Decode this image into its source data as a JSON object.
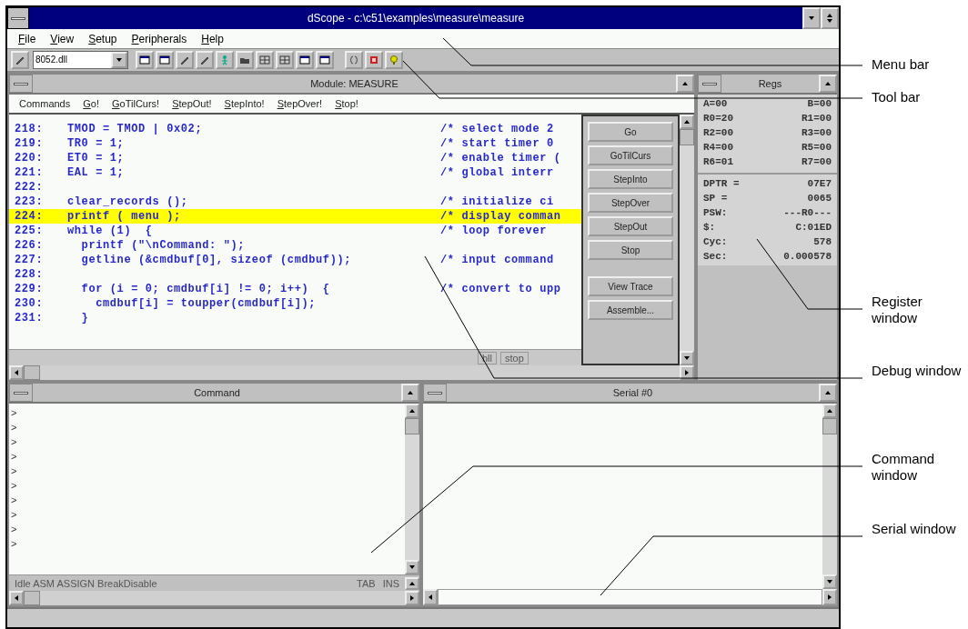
{
  "window": {
    "title": "dScope - c:\\c51\\examples\\measure\\measure"
  },
  "menu_bar": [
    "File",
    "View",
    "Setup",
    "Peripherals",
    "Help"
  ],
  "toolbar": {
    "dll_combo": "8052.dll"
  },
  "debug_window": {
    "title": "Module: MEASURE",
    "commands": [
      "Commands",
      "Go!",
      "GoTilCurs!",
      "StepOut!",
      "StepInto!",
      "StepOver!",
      "Stop!"
    ],
    "lines": [
      {
        "number": "218:",
        "code": "TMOD = TMOD | 0x02;",
        "comment": "/* select mode 2",
        "current": false
      },
      {
        "number": "219:",
        "code": "TR0 = 1;",
        "comment": "/* start timer 0",
        "current": false
      },
      {
        "number": "220:",
        "code": "ET0 = 1;",
        "comment": "/* enable timer (",
        "current": false
      },
      {
        "number": "221:",
        "code": "EAL = 1;",
        "comment": "/* global interr",
        "current": false
      },
      {
        "number": "222:",
        "current": false
      },
      {
        "number": "223:",
        "code": "clear_records ();",
        "comment": "/* initialize ci",
        "current": false
      },
      {
        "number": "224:",
        "code": "printf ( menu );",
        "comment": "/* display comman",
        "current": true
      },
      {
        "number": "225:",
        "code": "while (1)  {",
        "comment": "/* loop forever",
        "current": false
      },
      {
        "number": "226:",
        "code": "  printf (\"\\nCommand: \");",
        "current": false
      },
      {
        "number": "227:",
        "code": "  getline (&cmdbuf[0], sizeof (cmdbuf));",
        "comment": "/* input command",
        "current": false
      },
      {
        "number": "228:",
        "current": false
      },
      {
        "number": "229:",
        "code": "  for (i = 0; cmdbuf[i] != 0; i++)  {",
        "comment": "/* convert to upp",
        "current": false
      },
      {
        "number": "230:",
        "code": "    cmdbuf[i] = toupper(cmdbuf[i]);",
        "current": false
      },
      {
        "number": "231:",
        "code": "  }",
        "current": false
      }
    ],
    "buttons": [
      "Go",
      "GoTilCurs",
      "StepInto",
      "StepOver",
      "StepOut",
      "Stop",
      "View Trace",
      "Assemble..."
    ],
    "status": [
      "hll",
      "stop"
    ]
  },
  "regs_window": {
    "title": "Regs",
    "registers": [
      {
        "left": "A=00",
        "right": "B=00"
      },
      {
        "left": "R0=20",
        "right": "R1=00"
      },
      {
        "left": "R2=00",
        "right": "R3=00"
      },
      {
        "left": "R4=00",
        "right": "R5=00"
      },
      {
        "left": "R6=01",
        "right": "R7=00"
      }
    ],
    "values": [
      {
        "label": "DPTR =",
        "value": "07E7"
      },
      {
        "label": "SP =",
        "value": "0065"
      },
      {
        "label": "PSW:",
        "value": "---R0---"
      },
      {
        "label": "$:",
        "value": "C:01ED"
      },
      {
        "label": "Cyc:",
        "value": "578"
      },
      {
        "label": "Sec:",
        "value": "0.000578"
      }
    ]
  },
  "command_window": {
    "title": "Command",
    "lines": [
      ">",
      ">",
      ">",
      ">",
      ">",
      ">",
      ">",
      ">",
      ">",
      ">"
    ],
    "status": [
      "Idle ASM ASSIGN BreakDisable",
      "TAB",
      "INS"
    ]
  },
  "serial_window": {
    "title": "Serial #0"
  },
  "callouts": [
    {
      "text": "Menu bar"
    },
    {
      "text": "Tool bar"
    },
    {
      "text": "Register window"
    },
    {
      "text": "Debug window"
    },
    {
      "text": "Command window"
    },
    {
      "text": "Serial window"
    }
  ]
}
